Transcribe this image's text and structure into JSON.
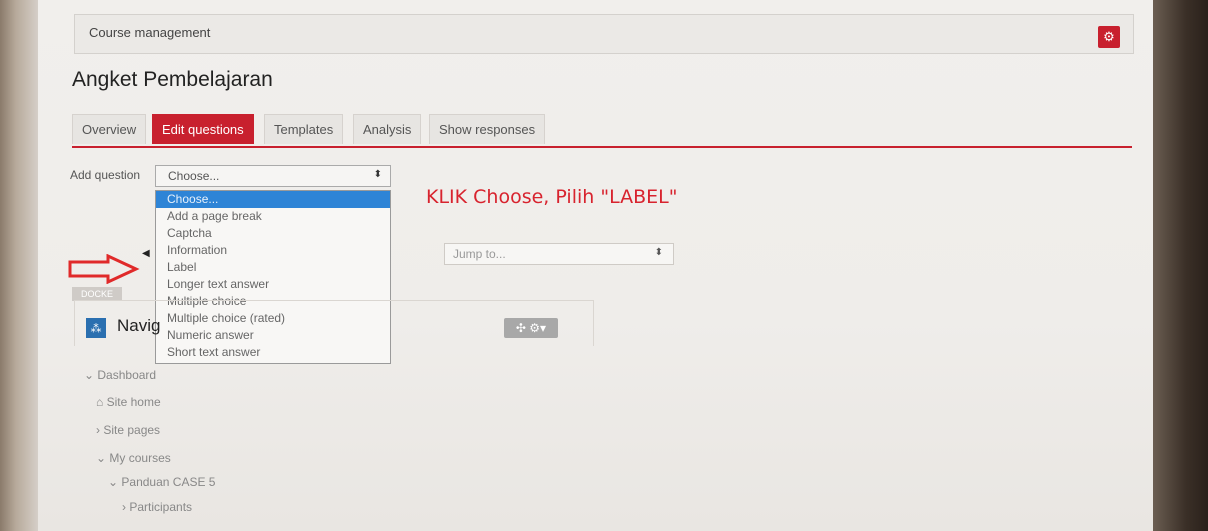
{
  "management": {
    "label": "Course management",
    "gear_icon": "gear-icon"
  },
  "page_title": "Angket Pembelajaran",
  "tabs": [
    {
      "label": "Overview",
      "active": false
    },
    {
      "label": "Edit questions",
      "active": true
    },
    {
      "label": "Templates",
      "active": false
    },
    {
      "label": "Analysis",
      "active": false
    },
    {
      "label": "Show responses",
      "active": false
    }
  ],
  "add_question": {
    "label": "Add question",
    "selected": "Choose...",
    "options": [
      "Choose...",
      "Add a page break",
      "Captcha",
      "Information",
      "Label",
      "Longer text answer",
      "Multiple choice",
      "Multiple choice (rated)",
      "Numeric answer",
      "Short text answer"
    ]
  },
  "instruction": "KLIK Choose, Pilih \"LABEL\"",
  "jump_to": {
    "placeholder": "Jump to..."
  },
  "gray_tag": "DOCKE",
  "navigation": {
    "title": "Navig",
    "move_label": "✣ ⚙▾"
  },
  "tree": {
    "dashboard": "Dashboard",
    "site_home": "Site home",
    "site_pages": "Site pages",
    "my_courses": "My courses",
    "course": "Panduan CASE 5",
    "participants": "Participants"
  },
  "colors": {
    "accent": "#c8202e",
    "selection": "#2e84d6",
    "instruction": "#d8232e"
  }
}
